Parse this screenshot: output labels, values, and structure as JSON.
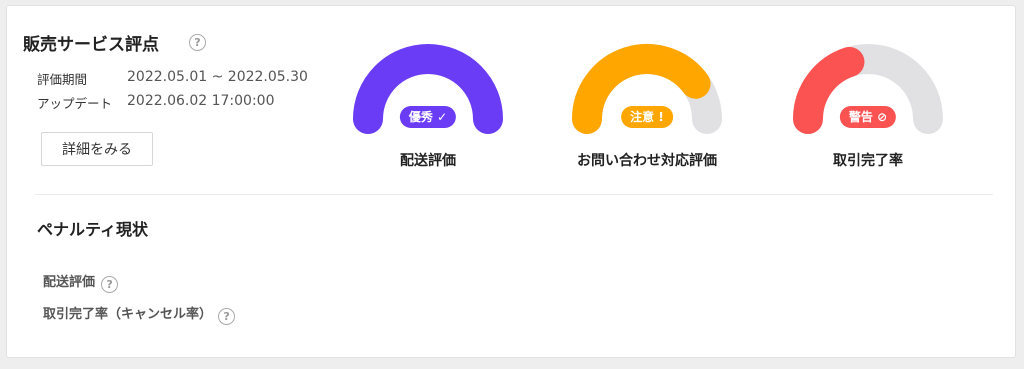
{
  "section": {
    "title": "販売サービス評点",
    "help_icon": "?",
    "period_label": "評価期間",
    "period_value": "2022.05.01 ~ 2022.05.30",
    "update_label": "アップデート",
    "update_value": "2022.06.02 17:00:00",
    "details_button": "詳細をみる"
  },
  "gauges": [
    {
      "label": "配送評価",
      "badge": "優秀",
      "badge_icon": "✓",
      "level": 1.0,
      "color": "#6b3cf5",
      "track": "#e1e1e4",
      "icon": "checkmark-icon"
    },
    {
      "label": "お問い合わせ対応評価",
      "badge": "注意",
      "badge_icon": "!",
      "level": 0.8,
      "color": "#ffa600",
      "track": "#e1e1e4",
      "icon": "exclamation-icon"
    },
    {
      "label": "取引完了率",
      "badge": "警告",
      "badge_icon": "⊘",
      "level": 0.4,
      "color": "#fb5252",
      "track": "#e1e1e4",
      "icon": "prohibited-icon"
    }
  ],
  "penalty": {
    "title": "ペナルティ現状",
    "rows": [
      {
        "label": "配送評価",
        "help": "?"
      },
      {
        "label": "取引完了率（キャンセル率）",
        "help": "?"
      }
    ]
  }
}
